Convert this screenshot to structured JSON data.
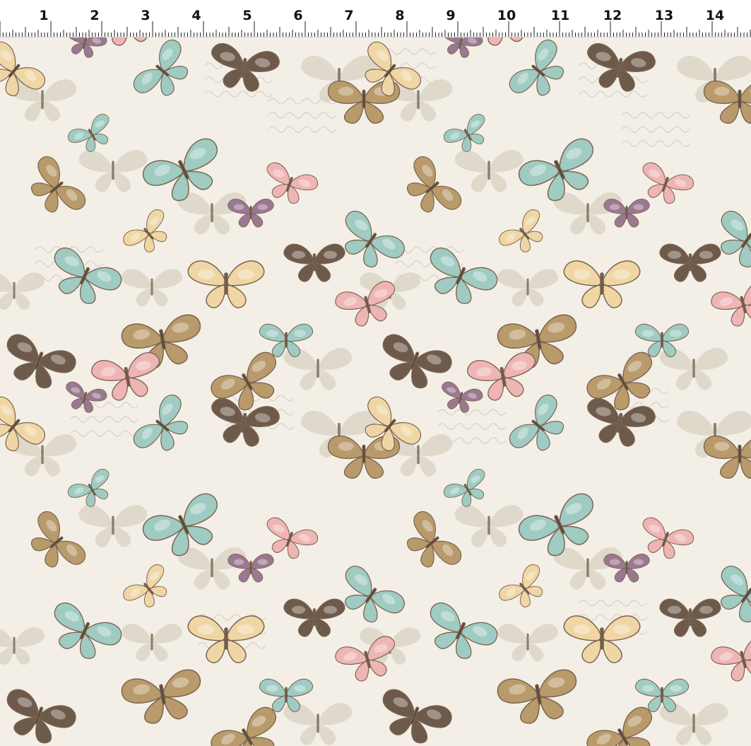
{
  "ruler": {
    "labels": [
      "1",
      "2",
      "3",
      "4",
      "5",
      "6",
      "7",
      "8",
      "9",
      "10",
      "11",
      "12",
      "13",
      "14"
    ]
  },
  "fabric": {
    "background_color": "#f3efe6",
    "palette": {
      "teal": "#9fcbc2",
      "brown": "#6e5a4a",
      "pink": "#efb5b5",
      "cream": "#efd6a4",
      "ghost": "#d9d2c4",
      "tan": "#b99a6a",
      "mauve": "#9b7891"
    },
    "motif": "vintage butterflies over faded handwritten script",
    "icon_names": [
      "butterfly-icon"
    ]
  }
}
